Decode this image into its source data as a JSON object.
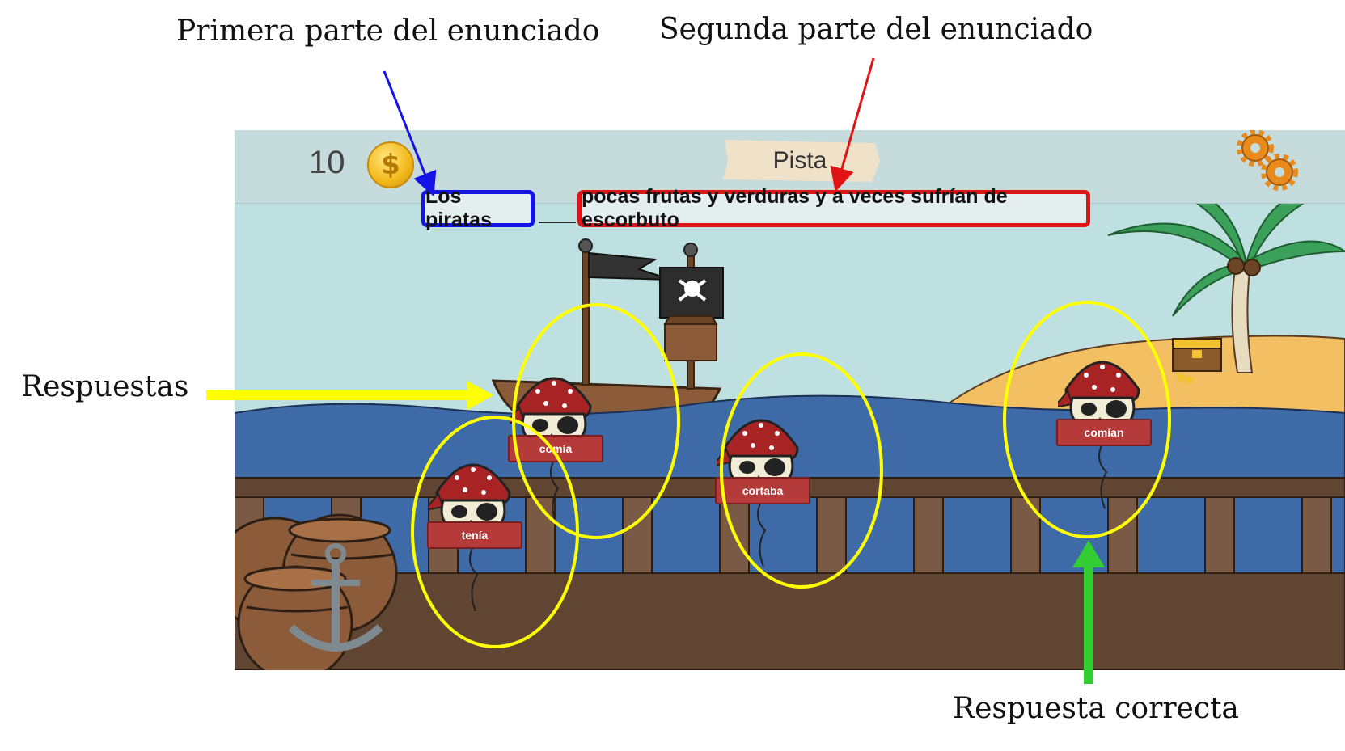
{
  "annotations": {
    "first_part_label": "Primera parte del enunciado",
    "second_part_label": "Segunda parte del enunciado",
    "answers_label": "Respuestas",
    "correct_answer_label": "Respuesta correcta"
  },
  "game": {
    "coins": "10",
    "coin_symbol": "$",
    "hint_button": "Pista",
    "statement": {
      "first_part": "Los piratas",
      "second_part": "pocas frutas y verduras y a veces sufrían de escorbuto"
    },
    "answers": [
      {
        "text": "tenía"
      },
      {
        "text": "comía"
      },
      {
        "text": "cortaba"
      },
      {
        "text": "comían",
        "correct": true
      }
    ]
  },
  "colors": {
    "first_part_highlight": "#1414e6",
    "second_part_highlight": "#e01414",
    "answers_highlight": "#ffff00",
    "correct_highlight": "#33cc33",
    "sea": "#3f6aa8",
    "deck": "#614533",
    "sky": "#bfe0e0"
  },
  "icons": [
    "coin-icon",
    "settings-gears-icon",
    "pirate-skull-icon",
    "anchor-icon",
    "barrel-icon",
    "palm-tree-icon",
    "treasure-chest-icon",
    "pirate-ship-icon"
  ]
}
